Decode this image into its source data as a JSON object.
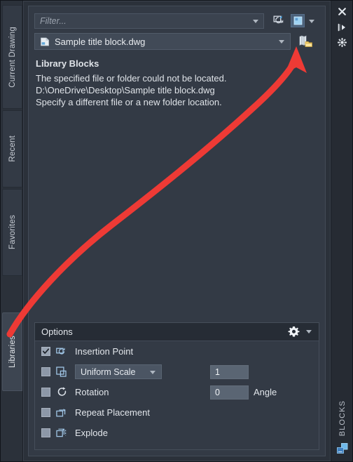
{
  "window": {
    "palette_name": "BLOCKS",
    "colors": {
      "panel_bg": "#333a45",
      "rail_bg": "#2b313a",
      "accent_blue": "#4a6079",
      "text": "#e2e6eb",
      "annotation_red": "#ee3a35"
    }
  },
  "left_tabs": [
    {
      "label": "Current Drawing",
      "selected": false
    },
    {
      "label": "Recent",
      "selected": false
    },
    {
      "label": "Favorites",
      "selected": false
    },
    {
      "label": "Libraries",
      "selected": true
    }
  ],
  "right_rail": {
    "icons": [
      {
        "name": "close-icon",
        "glyph": "✕"
      },
      {
        "name": "auto-hide-icon",
        "glyph": "◀"
      },
      {
        "name": "panel-properties-icon",
        "glyph": "✸"
      }
    ],
    "vertical_label": "BLOCKS"
  },
  "toolbar": {
    "filter": {
      "placeholder": "Filter...",
      "value": ""
    },
    "refresh_blocks_tooltip": "Refresh Blocks",
    "view_mode_tooltip": "Thumbnail View"
  },
  "library": {
    "file_name": "Sample title block.dwg",
    "browse_tooltip": "Browse Block Libraries"
  },
  "message": {
    "heading": "Library Blocks",
    "lines": [
      "The specified file or folder could not be located.",
      "D:\\OneDrive\\Desktop\\Sample title block.dwg",
      "Specify a different file or a new folder location."
    ]
  },
  "options": {
    "title": "Options",
    "rows": [
      {
        "label": "Insertion Point",
        "icon": "insertion-point-icon",
        "checked": true
      },
      {
        "label": "",
        "icon": "scale-icon",
        "checked": false,
        "scale_mode": "Uniform Scale",
        "scale_value": "1"
      },
      {
        "label": "Rotation",
        "icon": "rotation-icon",
        "checked": false,
        "angle_value": "0",
        "angle_label": "Angle"
      },
      {
        "label": "Repeat Placement",
        "icon": "repeat-placement-icon",
        "checked": false
      },
      {
        "label": "Explode",
        "icon": "explode-icon",
        "checked": false
      }
    ]
  }
}
